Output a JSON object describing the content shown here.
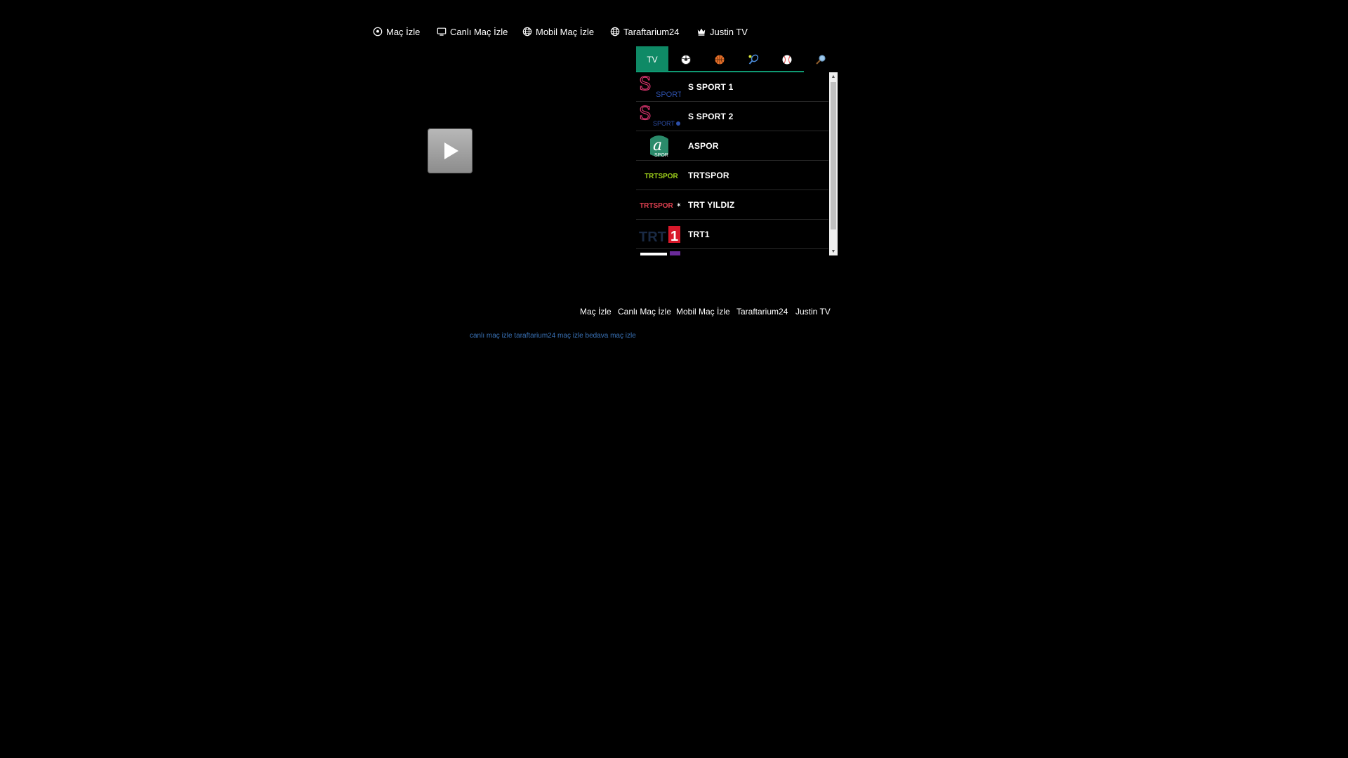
{
  "topnav": {
    "items": [
      {
        "label": "Maç İzle",
        "icon": "soccer-ball-icon"
      },
      {
        "label": "Canlı Maç İzle",
        "icon": "monitor-icon"
      },
      {
        "label": "Mobil Maç İzle",
        "icon": "globe-icon"
      },
      {
        "label": "Taraftarium24",
        "icon": "globe-icon"
      },
      {
        "label": "Justin TV",
        "icon": "crown-icon"
      }
    ]
  },
  "player": {
    "icon": "play-icon"
  },
  "tabs": {
    "items": [
      {
        "label": "TV",
        "icon": "tv-icon",
        "active": true
      },
      {
        "label": "",
        "icon": "soccer-ball-icon"
      },
      {
        "label": "",
        "icon": "basketball-icon"
      },
      {
        "label": "",
        "icon": "tennis-icon"
      },
      {
        "label": "",
        "icon": "baseball-icon"
      },
      {
        "label": "",
        "icon": "search-icon"
      }
    ],
    "accent": "#0f8a66"
  },
  "channels": [
    {
      "name": "S SPORT 1",
      "logo_text": "SPORT"
    },
    {
      "name": "S SPORT 2",
      "logo_text": "SPORT"
    },
    {
      "name": "ASPOR",
      "logo_text": "SPOR"
    },
    {
      "name": "TRTSPOR",
      "logo_text": "TRTSPOR"
    },
    {
      "name": "TRT YILDIZ",
      "logo_text": "TRTSPOR"
    },
    {
      "name": "TRT1",
      "logo_text": "TRT1"
    },
    {
      "name": "",
      "logo_text": ""
    }
  ],
  "footer": {
    "links": [
      "Maç İzle",
      "Canlı Maç İzle",
      "Mobil Maç İzle",
      "Taraftarium24",
      "Justin TV"
    ],
    "seo_text": "canlı maç izle taraftarium24 maç izle bedava maç izle"
  },
  "colors": {
    "background": "#000000",
    "accent": "#0f8a66",
    "link": "#3a73b8"
  }
}
